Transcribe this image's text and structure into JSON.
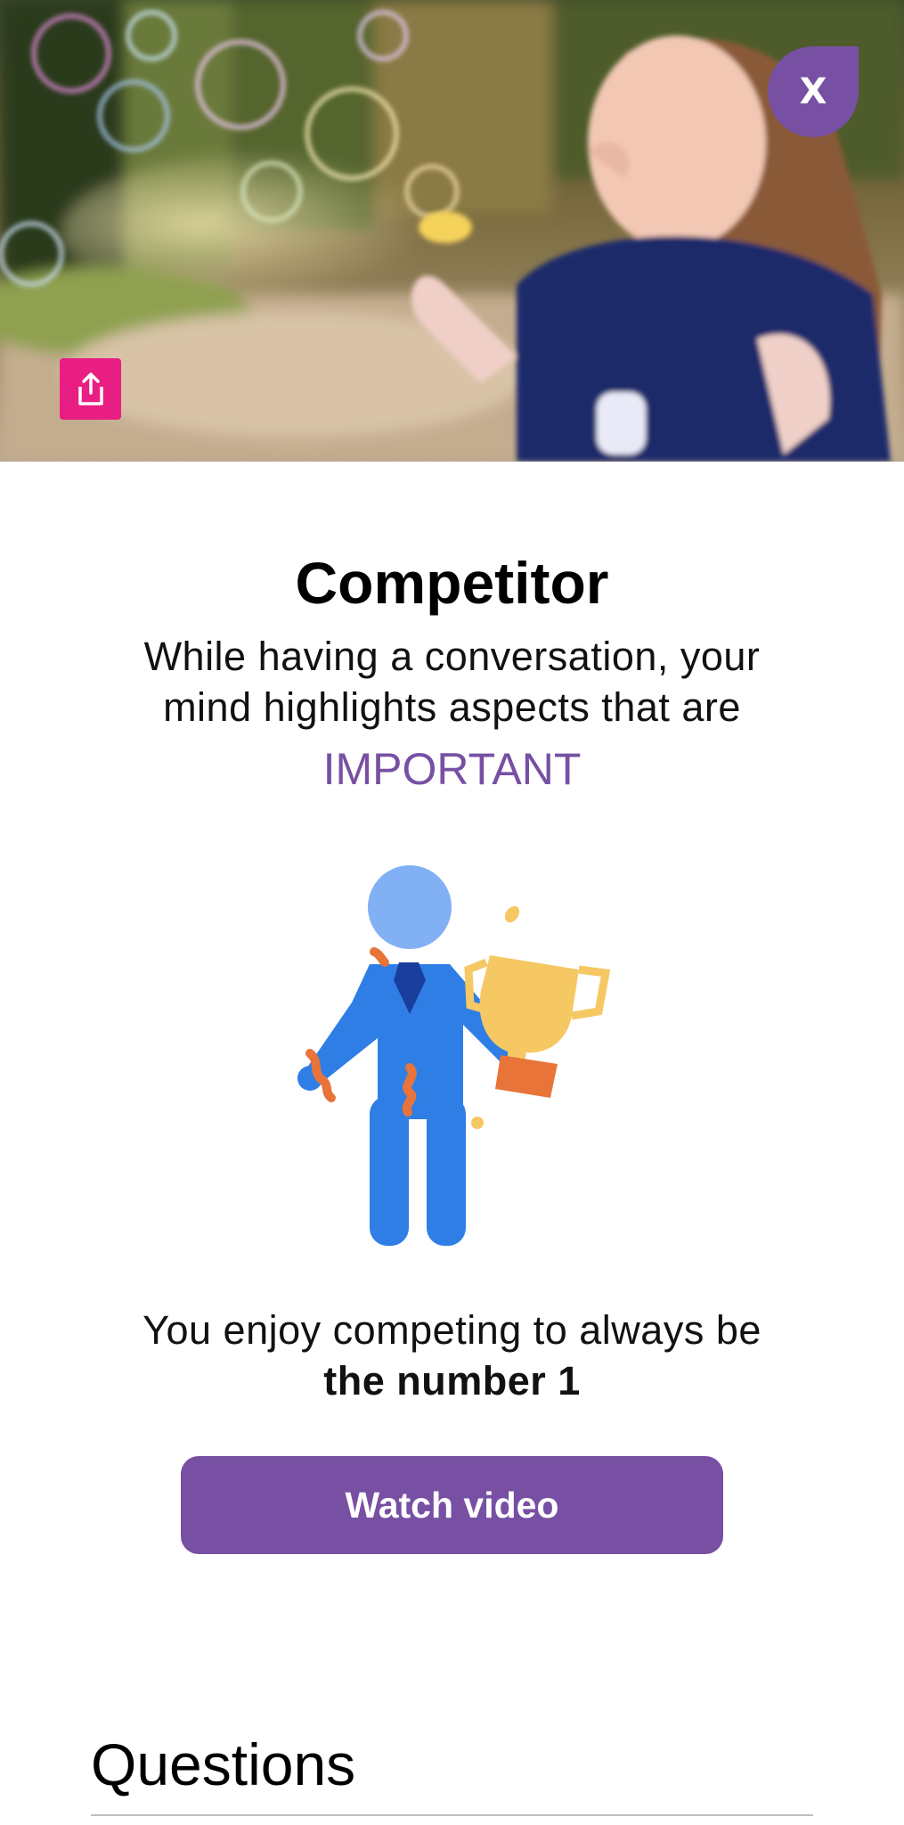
{
  "hero": {
    "close_label": "X",
    "share_icon": "share-icon"
  },
  "card": {
    "title": "Competitor",
    "description": "While having a conversation, your mind highlights aspects that are",
    "highlight": "IMPORTANT",
    "statement_prefix": "You enjoy competing to always be ",
    "statement_emphasis": "the number 1",
    "watch_video_label": "Watch video"
  },
  "questions": {
    "heading": "Questions"
  },
  "colors": {
    "accent": "#7750a3",
    "share": "#e91e82",
    "figure_blue": "#2f7ee6",
    "trophy": "#f6c863",
    "orange": "#e8743a"
  }
}
